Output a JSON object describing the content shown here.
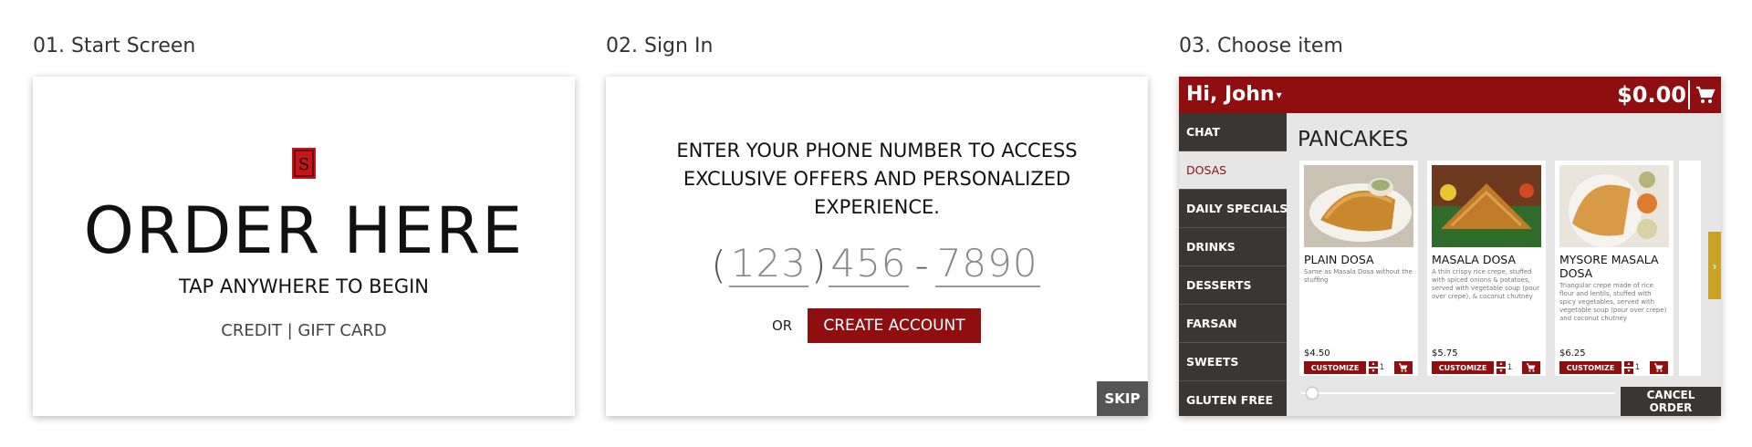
{
  "screens": [
    {
      "title": "01. Start Screen"
    },
    {
      "title": "02. Sign In"
    },
    {
      "title": "03. Choose item"
    }
  ],
  "start": {
    "headline": "ORDER HERE",
    "subline": "TAP ANYWHERE TO BEGIN",
    "payment_methods": "CREDIT | GIFT CARD",
    "logo_icon": "restaurant-logo-icon"
  },
  "signin": {
    "prompt": "ENTER YOUR PHONE NUMBER TO ACCESS EXCLUSIVE OFFERS AND PERSONALIZED EXPERIENCE.",
    "phone_placeholder": {
      "area": "123",
      "prefix": "456",
      "line": "7890"
    },
    "or_label": "OR",
    "create_account": "CREATE ACCOUNT",
    "skip": "SKIP"
  },
  "order": {
    "greeting": "Hi, John",
    "total": "$0.00",
    "categories": [
      "CHAT",
      "DOSAS",
      "DAILY SPECIALS",
      "DRINKS",
      "DESSERTS",
      "FARSAN",
      "SWEETS",
      "GLUTEN FREE"
    ],
    "active_category": "DOSAS",
    "section": "PANCAKES",
    "items": [
      {
        "name": "PLAIN DOSA",
        "desc": "Same as Masala Dosa without the stuffing",
        "price": "$4.50",
        "qty": "1"
      },
      {
        "name": "MASALA DOSA",
        "desc": "A thin crispy rice crepe, stuffed with spiced onions & potatoes, served with vegetable soup (pour over crepe), & coconut chutney",
        "price": "$5.75",
        "qty": "1"
      },
      {
        "name": "MYSORE MASALA DOSA",
        "desc": "Triangular crepe made of rice flour and lentils, stuffed with spicy vegetables, served with vegetable soup (pour over crepe) and coconut chutney",
        "price": "$6.25",
        "qty": "1"
      }
    ],
    "customize": "CUSTOMIZE",
    "cancel": "CANCEL ORDER",
    "colors": {
      "brand_red": "#8f0f11",
      "sidebar": "#3a3633",
      "accent_gold": "#c9a227"
    }
  }
}
